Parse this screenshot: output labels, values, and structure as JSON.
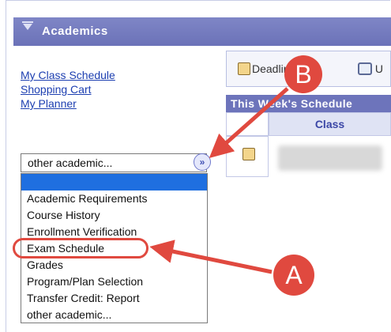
{
  "header": {
    "title": "Academics"
  },
  "links": [
    "My Class Schedule",
    "Shopping Cart",
    "My Planner"
  ],
  "select": {
    "value": "other academic..."
  },
  "dropdown": {
    "options": [
      "Academic Requirements",
      "Course History",
      "Enrollment Verification",
      "Exam Schedule",
      "Grades",
      "Program/Plan Selection",
      "Transfer Credit: Report",
      "other academic..."
    ]
  },
  "toolbar": {
    "deadlines": "Deadlines",
    "second": "U"
  },
  "schedule": {
    "header": "This Week's Schedule",
    "column": "Class"
  },
  "callouts": {
    "a": "A",
    "b": "B"
  },
  "colors": {
    "header": "#6d74bb",
    "link": "#1d3fb1",
    "callout": "#e0493f",
    "highlight": "#1f6fe0"
  }
}
